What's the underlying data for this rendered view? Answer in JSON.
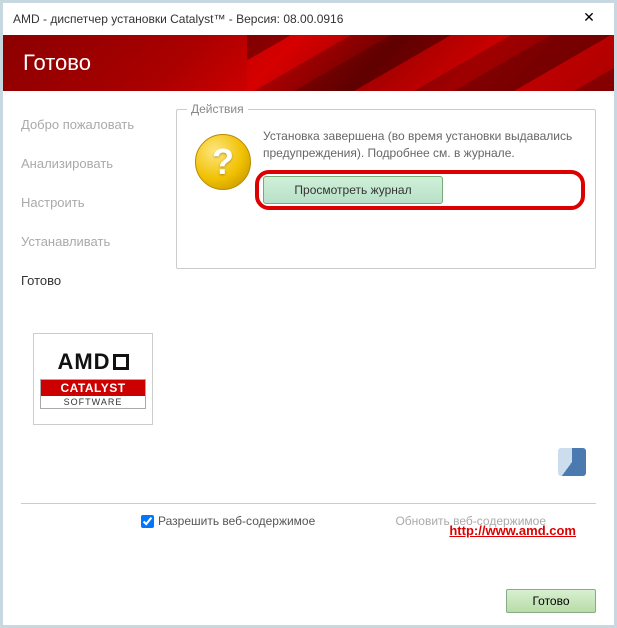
{
  "titlebar": {
    "text": "AMD - диспетчер установки Catalyst™ - Версия: 08.00.0916"
  },
  "header": {
    "title": "Готово"
  },
  "sidebar": {
    "items": [
      {
        "label": "Добро пожаловать"
      },
      {
        "label": "Анализировать"
      },
      {
        "label": "Настроить"
      },
      {
        "label": "Устанавливать"
      },
      {
        "label": "Готово"
      }
    ]
  },
  "panel": {
    "legend": "Действия",
    "message": "Установка завершена (во время установки выдавались предупреждения). Подробнее см. в журнале.",
    "view_log_label": "Просмотреть журнал"
  },
  "logo": {
    "brand": "AMD",
    "line1": "CATALYST",
    "line2": "SOFTWARE"
  },
  "web": {
    "allow_label": "Разрешить веб-содержимое",
    "update_label": "Обновить веб-содержимое",
    "link_text": "http://www.amd.com"
  },
  "footer": {
    "done_label": "Готово"
  }
}
